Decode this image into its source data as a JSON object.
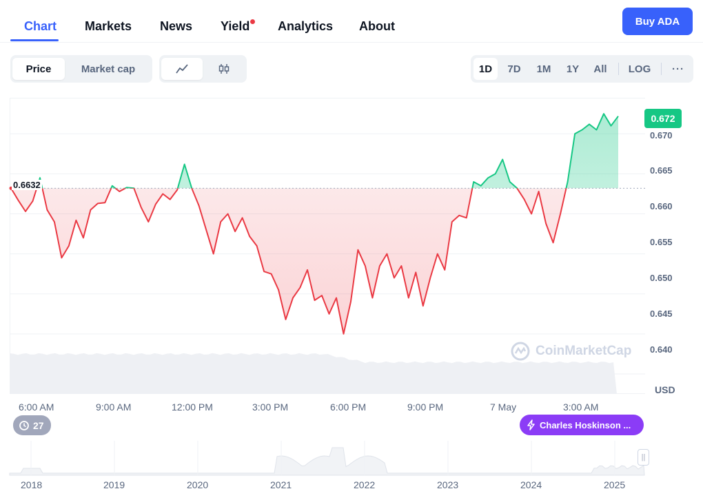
{
  "nav": {
    "tabs": [
      {
        "label": "Chart",
        "active": true
      },
      {
        "label": "Markets"
      },
      {
        "label": "News"
      },
      {
        "label": "Yield",
        "badge": true
      },
      {
        "label": "Analytics"
      },
      {
        "label": "About"
      }
    ],
    "buy_label": "Buy ADA"
  },
  "controls": {
    "metric": [
      "Price",
      "Market cap"
    ],
    "metric_selected": "Price",
    "chart_types": [
      "line-chart-icon",
      "candlestick-icon"
    ],
    "ranges": [
      "1D",
      "7D",
      "1M",
      "1Y",
      "All"
    ],
    "range_selected": "1D",
    "log_label": "LOG",
    "more_label": "···"
  },
  "chart": {
    "open_label": "0.6632",
    "price_tag": "0.672",
    "y_ticks": [
      "0.670",
      "0.665",
      "0.660",
      "0.655",
      "0.650",
      "0.645",
      "0.640"
    ],
    "x_ticks": [
      "6:00 AM",
      "9:00 AM",
      "12:00 PM",
      "3:00 PM",
      "6:00 PM",
      "9:00 PM",
      "7 May",
      "3:00 AM"
    ],
    "currency": "USD",
    "watermark": "CoinMarketCap",
    "colors": {
      "up": "#16c784",
      "down": "#ea3943",
      "accent": "#3861fb"
    }
  },
  "chart_data": {
    "type": "line",
    "baseline": 0.6632,
    "ylim": [
      0.6375,
      0.6745
    ],
    "x": [
      "04:00",
      "04:17",
      "04:34",
      "04:51",
      "05:08",
      "05:25",
      "05:42",
      "05:59",
      "06:16",
      "06:33",
      "06:50",
      "07:07",
      "07:24",
      "07:41",
      "07:58",
      "08:15",
      "08:32",
      "08:49",
      "09:06",
      "09:23",
      "09:40",
      "09:57",
      "10:14",
      "10:31",
      "10:48",
      "11:05",
      "11:22",
      "11:39",
      "11:56",
      "12:13",
      "12:30",
      "12:47",
      "13:04",
      "13:21",
      "13:38",
      "13:55",
      "14:12",
      "14:29",
      "14:46",
      "15:03",
      "15:20",
      "15:37",
      "15:54",
      "16:11",
      "16:28",
      "16:45",
      "17:02",
      "17:19",
      "17:36",
      "17:53",
      "18:10",
      "18:27",
      "18:44",
      "19:01",
      "19:18",
      "19:35",
      "19:52",
      "20:09",
      "20:26",
      "20:43",
      "21:00",
      "21:17",
      "21:34",
      "21:51",
      "22:08",
      "22:25",
      "22:42",
      "22:59",
      "23:16",
      "23:33",
      "23:50",
      "00:07",
      "00:24",
      "00:41",
      "00:58",
      "01:15",
      "01:32",
      "01:49",
      "02:06",
      "02:23",
      "02:40",
      "02:57",
      "03:14",
      "03:31",
      "03:48"
    ],
    "values": [
      0.6632,
      0.6617,
      0.6603,
      0.6616,
      0.6645,
      0.6605,
      0.659,
      0.6545,
      0.656,
      0.6592,
      0.657,
      0.6605,
      0.6613,
      0.6614,
      0.6635,
      0.6628,
      0.6633,
      0.6632,
      0.6608,
      0.659,
      0.6612,
      0.6625,
      0.6618,
      0.663,
      0.6662,
      0.6632,
      0.661,
      0.658,
      0.655,
      0.659,
      0.66,
      0.6578,
      0.6595,
      0.6572,
      0.656,
      0.6528,
      0.6525,
      0.6505,
      0.6468,
      0.6495,
      0.6508,
      0.653,
      0.6492,
      0.6498,
      0.6475,
      0.6495,
      0.645,
      0.649,
      0.6555,
      0.6535,
      0.6495,
      0.6535,
      0.655,
      0.652,
      0.6535,
      0.6495,
      0.6527,
      0.6485,
      0.652,
      0.655,
      0.653,
      0.659,
      0.6598,
      0.6595,
      0.664,
      0.6635,
      0.6645,
      0.665,
      0.6668,
      0.664,
      0.6632,
      0.6618,
      0.66,
      0.6628,
      0.6588,
      0.6564,
      0.66,
      0.664,
      0.67,
      0.6705,
      0.6712,
      0.6705,
      0.6725,
      0.671,
      0.6722
    ],
    "title": "",
    "xlabel": "",
    "ylabel": "USD"
  },
  "badges": {
    "history_count": "27",
    "news_label": "Charles Hoskinson ..."
  },
  "overview": {
    "years": [
      "2018",
      "2019",
      "2020",
      "2021",
      "2022",
      "2023",
      "2024",
      "2025"
    ]
  }
}
